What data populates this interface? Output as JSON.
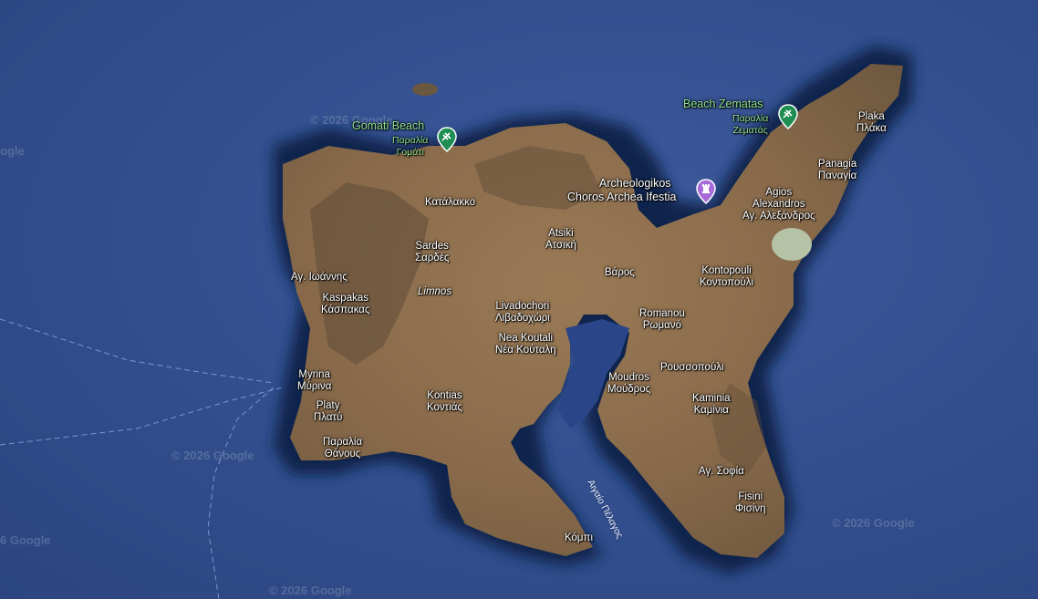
{
  "colors": {
    "sea": "#34508f",
    "land": "#8a6b4a",
    "shallow": "#0e2147",
    "poi_green": "#1e8e52",
    "poi_purple": "#a86bd8"
  },
  "pois": {
    "gomati": {
      "name": "Gomati Beach",
      "local": "Παραλία Γομάτι",
      "local1": "Παραλία",
      "local2": "Γομάτι",
      "icon": "beach-icon"
    },
    "zematas": {
      "name": "Beach Zematas",
      "local1": "Παραλία",
      "local2": "Ζεματάς",
      "icon": "beach-icon"
    },
    "hephaistia": {
      "line1": "Archeologikos",
      "line2": "Choros Archea Ifestia",
      "icon": "monument-icon"
    }
  },
  "places": {
    "katalakko": "Κατάλακκο",
    "sardes_en": "Sardes",
    "sardes_gr": "Σαρδές",
    "atsiki_en": "Atsiki",
    "atsiki_gr": "Ατσική",
    "varos": "Βάρος",
    "ag_ioannis": "Αγ. Ιωάννης",
    "kaspakas_en": "Kaspakas",
    "kaspakas_gr": "Κάσπακας",
    "limnos": "Limnos",
    "livadochori_en": "Livadochori",
    "livadochori_gr": "Λιβαδοχώρι",
    "nea_koutali_en": "Nea Koutali",
    "nea_koutali_gr": "Νέα Κούταλη",
    "myrina_en": "Myrina",
    "myrina_gr": "Μύρινα",
    "platy_en": "Platy",
    "platy_gr": "Πλατύ",
    "thanos_1": "Παραλία",
    "thanos_2": "Θάνους",
    "kontias_en": "Kontias",
    "kontias_gr": "Κοντιάς",
    "moudros_en": "Moudros",
    "moudros_gr": "Μούδρος",
    "romanou_en": "Romanou",
    "romanou_gr": "Ρωμανό",
    "roussopouli": "Ρουσσοπούλι",
    "kontopouli_en": "Kontopouli",
    "kontopouli_gr": "Κοντοπούλι",
    "kaminia_en": "Kaminia",
    "kaminia_gr": "Καμίνια",
    "ag_sofia": "Αγ. Σοφία",
    "fisini_en": "Fisini",
    "fisini_gr": "Φισίνη",
    "kompi": "Κόμπι",
    "plaka_en": "Plaka",
    "plaka_gr": "Πλάκα",
    "panagia_en": "Panagia",
    "panagia_gr": "Παναγία",
    "agios_alex_1": "Agios",
    "agios_alex_2": "Alexandros",
    "agios_alex_gr": "Αγ. Αλεξάνδρος"
  },
  "sea_label": "Αιγαίο Πέλαγος",
  "watermark": "© 2026 Google",
  "watermark_partial": "ogle",
  "watermark_partial2": "6 Google"
}
